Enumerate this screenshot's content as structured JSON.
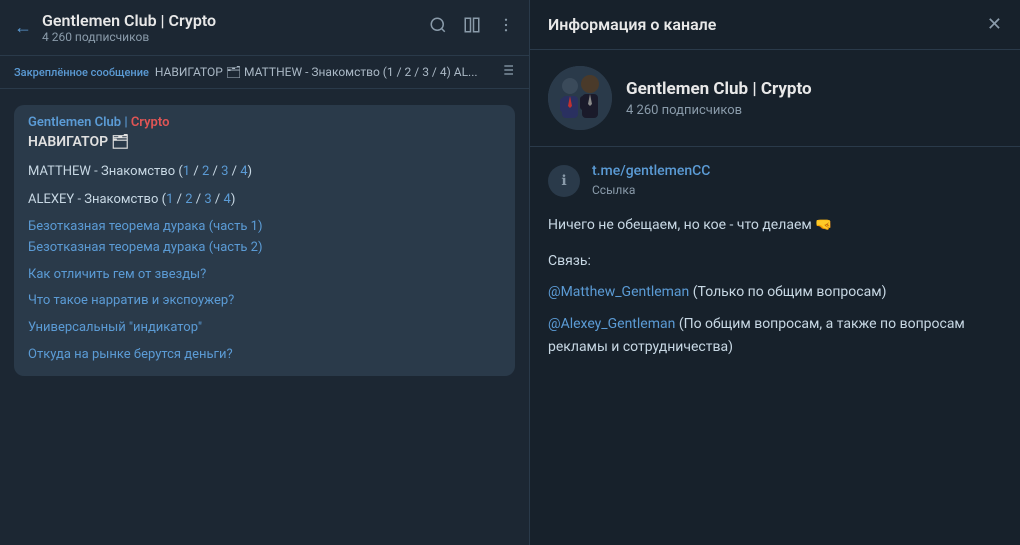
{
  "left": {
    "header": {
      "title": "Gentlemen Club | Crypto",
      "subscribers": "4 260 подписчиков",
      "back_label": "←",
      "search_icon": "search",
      "columns_icon": "columns",
      "more_icon": "more"
    },
    "pinned": {
      "label": "Закреплённое сообщение",
      "text": "НАВИГАТОР 🗂  MATTHEW - Знакомство (1 / 2 / 3 / 4)  AL...",
      "icon": "pin-list"
    },
    "message": {
      "sender": "Gentlemen Club | ",
      "sender_crypto": "Crypto",
      "navigator": "НАВИГАТОР 🗂",
      "matthew_label": "MATTHEW - Знакомство (",
      "matthew_links": [
        "1",
        "2",
        "3",
        "4"
      ],
      "alexey_label": "ALEXEY - Знакомство (",
      "alexey_links": [
        "1",
        "2",
        "3",
        "4"
      ],
      "links": [
        "Безотказная теорема дурака (часть 1)",
        "Безотказная теорема дурака (часть 2)",
        "Как отличить гем от звезды?",
        "Что такое нарратив и экспоужер?",
        "Универсальный \"индикатор\"",
        "Откуда на рынке берутся деньги?"
      ]
    }
  },
  "right": {
    "header": {
      "title": "Информация о канале",
      "close_label": "✕"
    },
    "channel": {
      "name": "Gentlemen Club | Crypto",
      "subscribers": "4 260 подписчиков"
    },
    "link": {
      "url": "t.me/gentlemenCC",
      "label": "Ссылка"
    },
    "description": "Ничего не обещаем, но кое - что делаем 🤜",
    "contacts_header": "Связь:",
    "contact1": {
      "mention": "@Matthew_Gentleman",
      "text": " (Только по общим вопросам)"
    },
    "contact2": {
      "mention": "@Alexey_Gentleman",
      "text": " (По общим вопросам, а также по вопросам рекламы и сотрудничества)"
    }
  }
}
